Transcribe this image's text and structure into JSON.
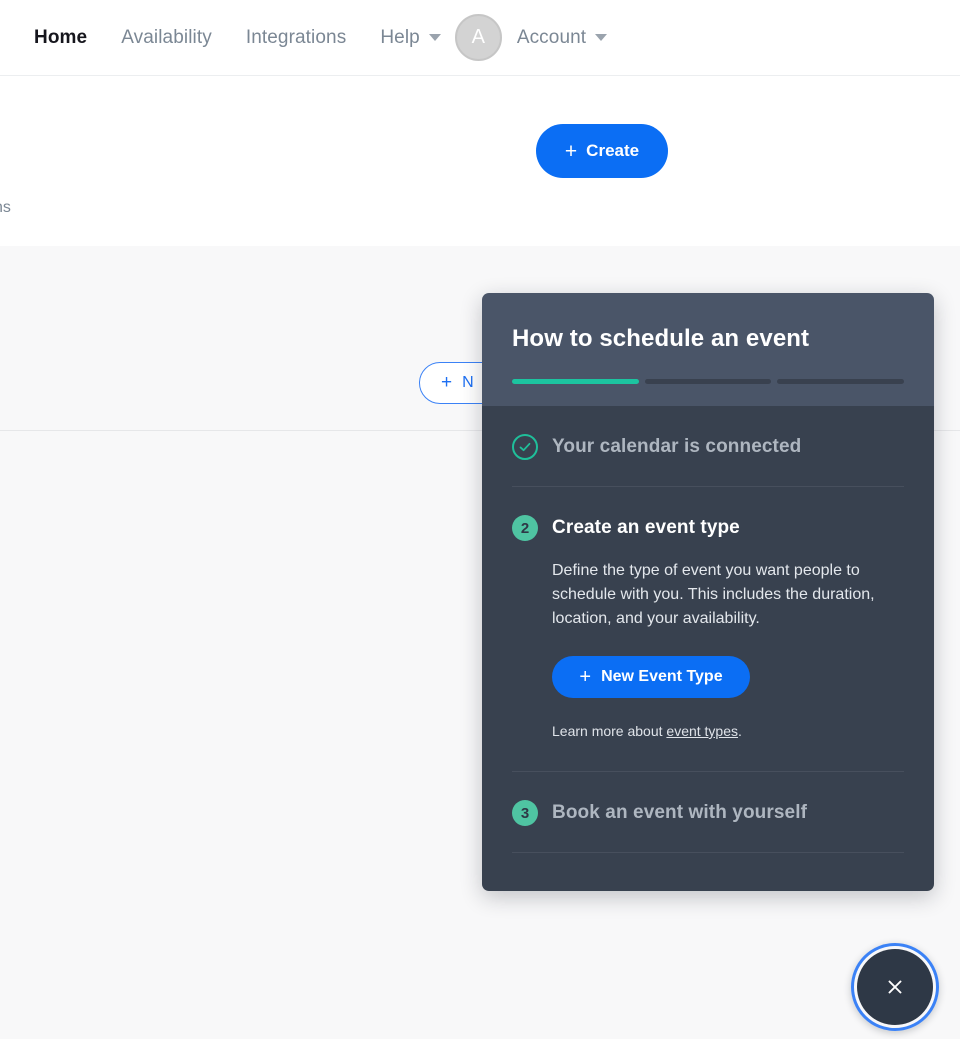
{
  "nav": {
    "items": [
      {
        "label": "Home",
        "active": true
      },
      {
        "label": "Availability",
        "active": false
      },
      {
        "label": "Integrations",
        "active": false
      }
    ],
    "help": {
      "label": "Help",
      "caret_icon": "chevron-down-icon"
    },
    "avatar": {
      "initial": "A"
    },
    "account": {
      "label": "Account",
      "caret_icon": "chevron-down-icon"
    }
  },
  "page": {
    "create_button": {
      "label": "Create",
      "icon": "plus-icon",
      "color": "#0b6ef4"
    },
    "clipped_text": "ns",
    "new_event_type_outline": {
      "label": "N",
      "icon": "plus-icon",
      "color": "#1d6ff2"
    }
  },
  "modal": {
    "title": "How to schedule an event",
    "header_color": "#4a5568",
    "body_color": "#38414f",
    "progress": {
      "total": 3,
      "completed": 1,
      "fill_color": "#1cc4a0",
      "track_color": "#39414f"
    },
    "steps": [
      {
        "badge": "check",
        "badge_icon": "check-circle-icon",
        "title": "Your calendar is connected",
        "state": "complete"
      },
      {
        "badge": "2",
        "title": "Create an event type",
        "state": "active",
        "description": "Define the type of event you want people to schedule with you. This includes the duration, location, and your availability.",
        "cta": {
          "label": "New Event Type",
          "icon": "plus-icon",
          "color": "#0b6ef4"
        },
        "learn_prefix": "Learn more about ",
        "learn_link": "event types",
        "learn_suffix": "."
      },
      {
        "badge": "3",
        "title": "Book an event with yourself",
        "state": "upcoming"
      }
    ]
  },
  "close_fab": {
    "icon": "close-icon",
    "ring_color": "#3b82f6",
    "fill_color": "#2e3846"
  }
}
